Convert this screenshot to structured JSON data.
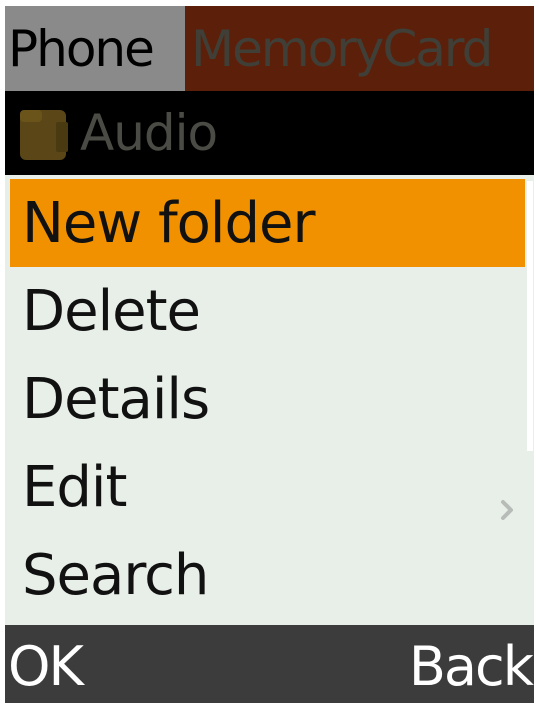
{
  "tabs": [
    {
      "label": "Phone",
      "active": true
    },
    {
      "label": "MemoryCard",
      "active": false
    }
  ],
  "folder": {
    "icon": "folder-icon",
    "title": "Audio"
  },
  "menu": {
    "items": [
      {
        "label": "New folder",
        "selected": true
      },
      {
        "label": "Delete"
      },
      {
        "label": "Details"
      },
      {
        "label": "Edit",
        "has_submenu": true
      },
      {
        "label": "Search"
      }
    ]
  },
  "softkeys": {
    "left": "OK",
    "right": "Back"
  },
  "colors": {
    "selection": "#f19100",
    "menu_background": "#e8efe8",
    "phone_tab": "#8a8a8a",
    "memorycard_tab": "#5c1f0a",
    "softkey_bar": "#3c3c3c"
  }
}
